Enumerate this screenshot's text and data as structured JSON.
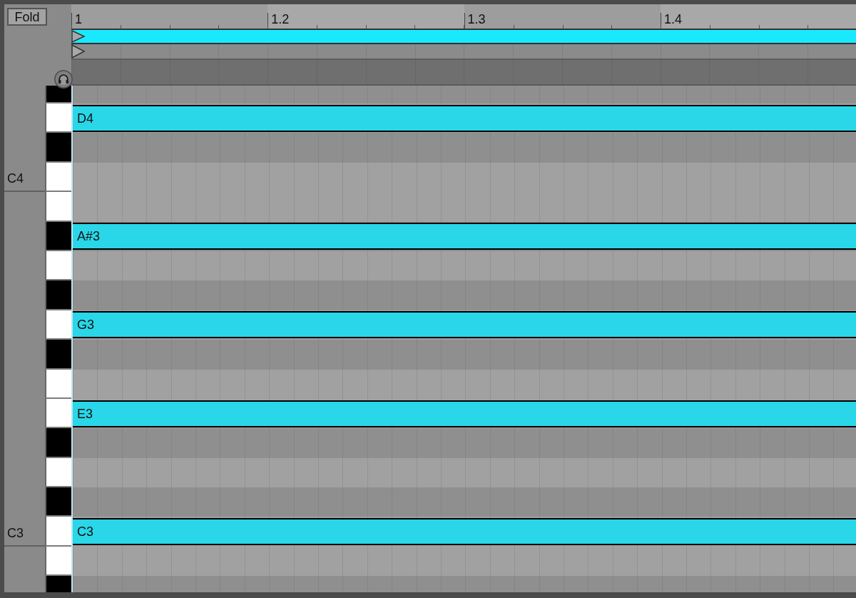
{
  "fold_button": {
    "label": "Fold"
  },
  "ruler": {
    "labels": [
      "1",
      "1.2",
      "1.3",
      "1.4"
    ]
  },
  "rows": [
    {
      "kind": "black"
    },
    {
      "kind": "white",
      "note": "D4"
    },
    {
      "kind": "black"
    },
    {
      "kind": "white",
      "octave_label": "C4"
    },
    {
      "kind": "white"
    },
    {
      "kind": "black",
      "note": "A#3"
    },
    {
      "kind": "white"
    },
    {
      "kind": "black"
    },
    {
      "kind": "white",
      "note": "G3"
    },
    {
      "kind": "black"
    },
    {
      "kind": "white"
    },
    {
      "kind": "white",
      "note": "E3"
    },
    {
      "kind": "black"
    },
    {
      "kind": "white"
    },
    {
      "kind": "black"
    },
    {
      "kind": "white",
      "note": "C3",
      "octave_label": "C3"
    },
    {
      "kind": "white"
    },
    {
      "kind": "black"
    }
  ]
}
